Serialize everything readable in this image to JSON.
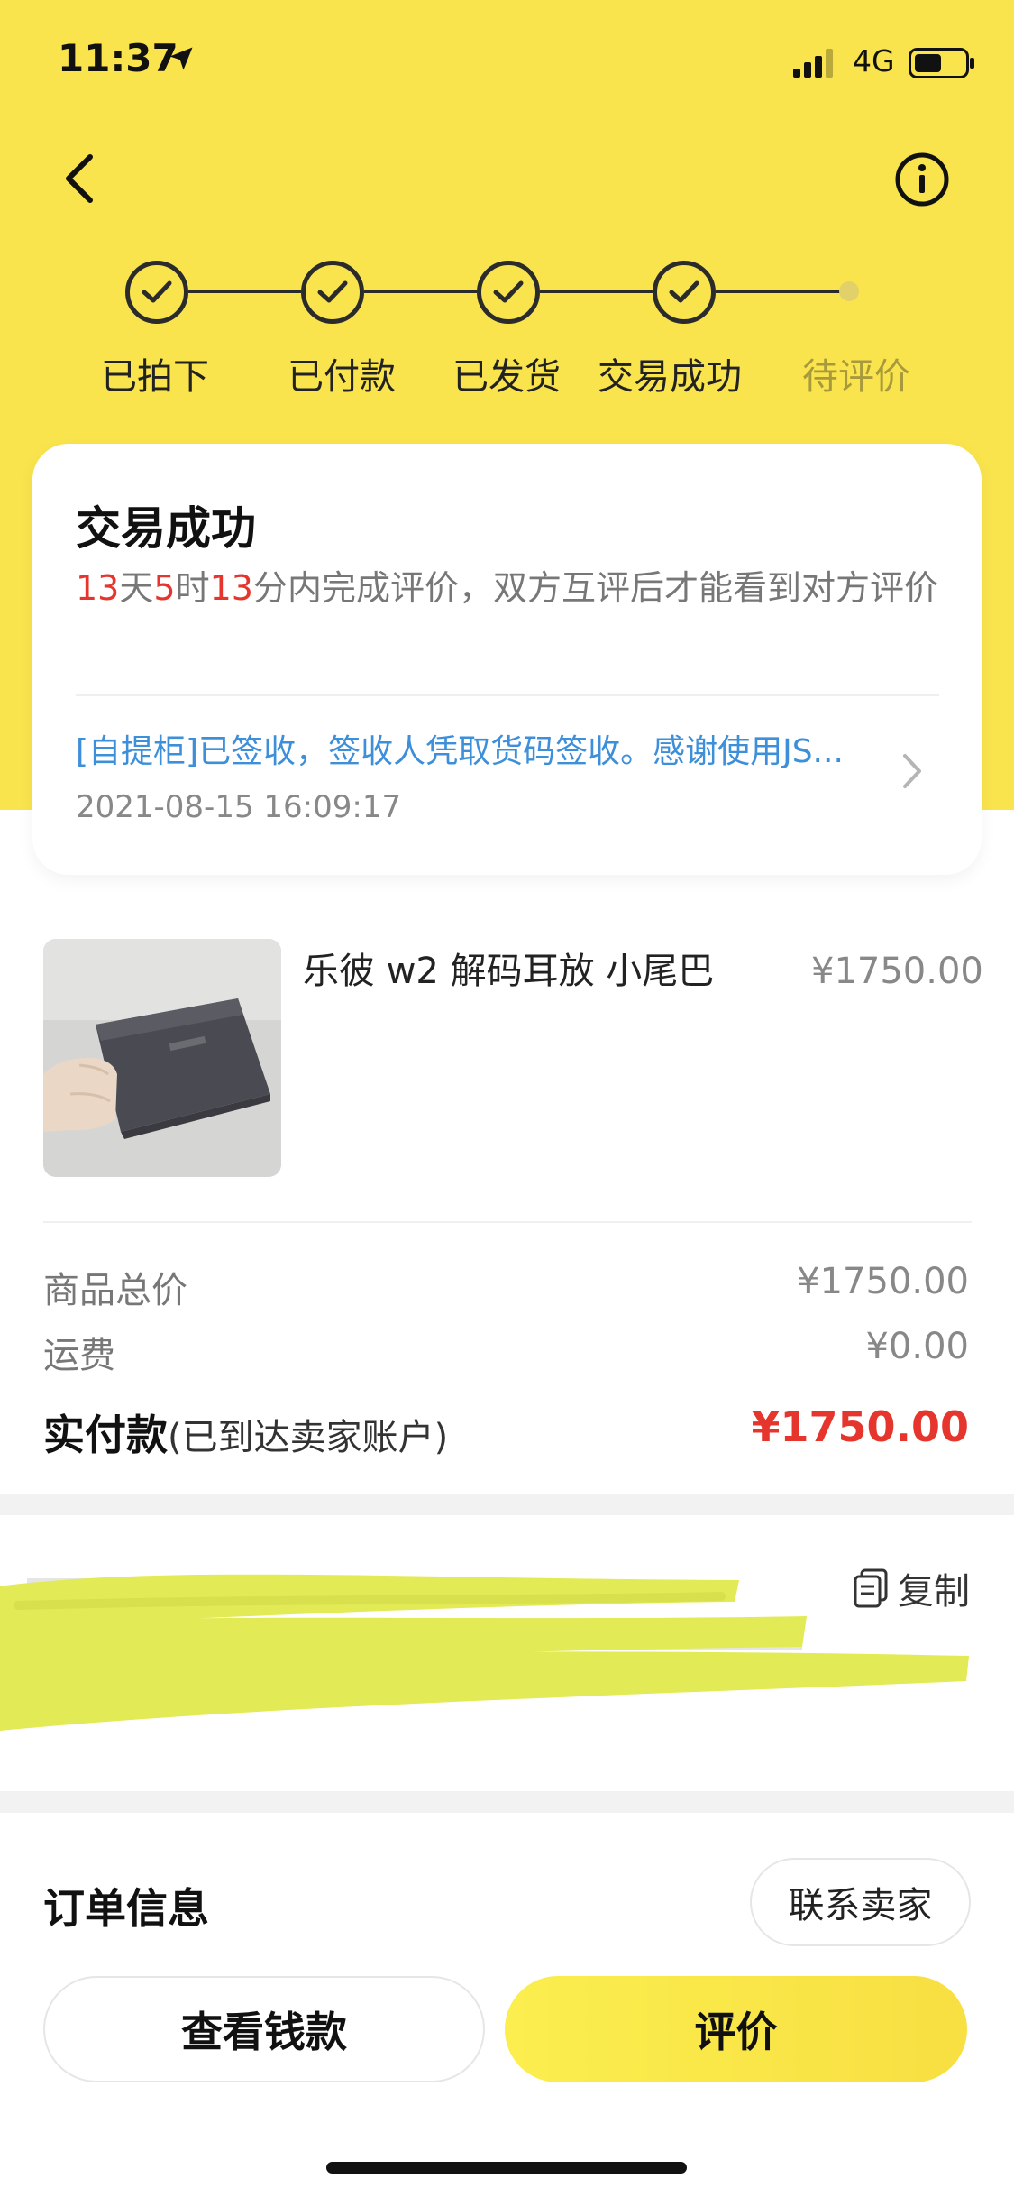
{
  "status_bar": {
    "time": "11:37",
    "network": "4G"
  },
  "progress": {
    "steps": [
      {
        "label": "已拍下",
        "done": true
      },
      {
        "label": "已付款",
        "done": true
      },
      {
        "label": "已发货",
        "done": true
      },
      {
        "label": "交易成功",
        "done": true
      },
      {
        "label": "待评价",
        "done": false
      }
    ]
  },
  "status_card": {
    "title": "交易成功",
    "countdown": {
      "days": "13",
      "days_unit": "天",
      "hours": "5",
      "hours_unit": "时",
      "minutes": "13",
      "rest": "分内完成评价，双方互评后才能看到对方评价"
    },
    "logistics": {
      "text": "[自提柜]已签收，签收人凭取货码签收。感谢使用JS...",
      "time": "2021-08-15 16:09:17"
    }
  },
  "product": {
    "title": "乐彼 w2 解码耳放 小尾巴",
    "price": "¥1750.00"
  },
  "fees": {
    "subtotal_label": "商品总价",
    "subtotal_value": "¥1750.00",
    "shipping_label": "运费",
    "shipping_value": "¥0.00",
    "paid_label": "实付款",
    "paid_note": "(已到达卖家账户)",
    "paid_value": "¥1750.00"
  },
  "address": {
    "copy_label": "复制"
  },
  "order_info": {
    "title": "订单信息",
    "contact_seller": "联系卖家"
  },
  "actions": {
    "view_money": "查看钱款",
    "review": "评价"
  },
  "colors": {
    "brand_yellow": "#f9e44d",
    "price_red": "#e5352d",
    "link_blue": "#3d8fd9"
  },
  "icons": [
    "location-arrow-icon",
    "signal-icon",
    "battery-icon",
    "back-arrow-icon",
    "info-icon",
    "check-icon",
    "chevron-right-icon",
    "copy-icon"
  ]
}
